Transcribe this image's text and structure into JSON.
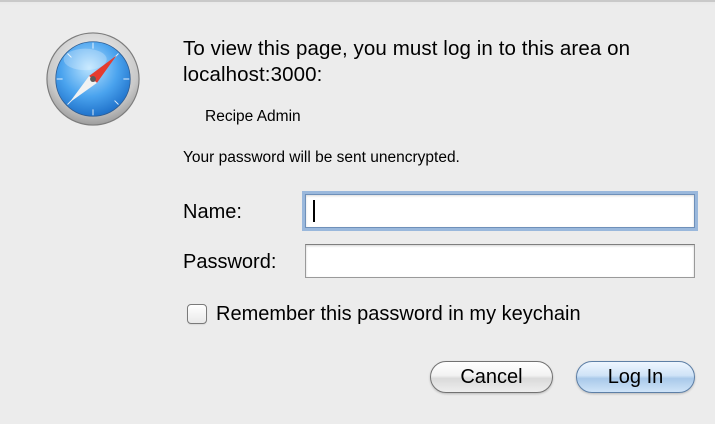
{
  "dialog": {
    "icon": "safari-compass-icon",
    "message": "To view this page, you must log in to this area on localhost:3000:",
    "realm": "Recipe Admin",
    "warning": "Your password will be sent unencrypted."
  },
  "form": {
    "name_label": "Name:",
    "name_value": "",
    "password_label": "Password:",
    "password_value": "",
    "remember_label": "Remember this password in my keychain",
    "remember_checked": false
  },
  "buttons": {
    "cancel_label": "Cancel",
    "login_label": "Log In"
  },
  "colors": {
    "background": "#ececec",
    "focus_ring": "#9ab8dc",
    "default_button": "#a9c9ea"
  }
}
